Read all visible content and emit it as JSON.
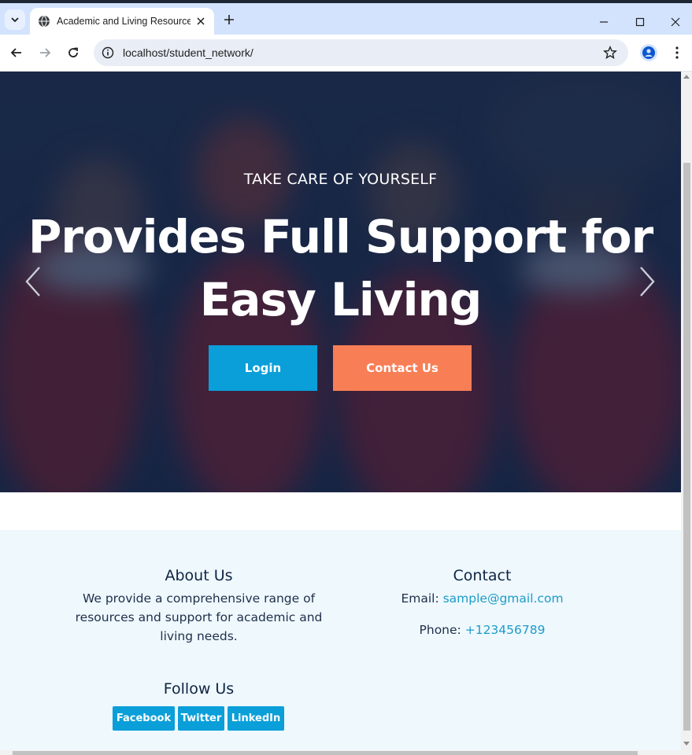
{
  "browser": {
    "tab_title": "Academic and Living Resource Network",
    "url": "localhost/student_network/",
    "icons": {
      "tab_search": "chevron-down-icon",
      "favicon": "globe-icon",
      "tab_close": "close-icon",
      "new_tab": "plus-icon",
      "back": "arrow-left-icon",
      "forward": "arrow-right-icon",
      "reload": "reload-icon",
      "site_info": "info-icon",
      "bookmark": "star-icon",
      "profile": "person-icon",
      "menu": "more-vertical-icon",
      "minimize": "minimize-icon",
      "maximize": "maximize-icon",
      "close": "close-icon"
    }
  },
  "hero": {
    "subtitle": "TAKE CARE OF YOURSELF",
    "title": "Provides Full Support for Easy Living",
    "login_label": "Login",
    "contact_label": "Contact Us"
  },
  "footer": {
    "about": {
      "heading": "About Us",
      "text": "We provide a comprehensive range of resources and support for academic and living needs."
    },
    "follow": {
      "heading": "Follow Us",
      "links": [
        "Facebook",
        "Twitter",
        "LinkedIn"
      ]
    },
    "contact": {
      "heading": "Contact",
      "email_label": "Email:",
      "email": "sample@gmail.com",
      "phone_label": "Phone:",
      "phone": "+123456789"
    }
  },
  "colors": {
    "primary_button": "#0a9fd9",
    "contact_button": "#f87e55",
    "footer_bg": "#eef8fd",
    "link": "#1d9cc9",
    "hero_overlay": "#1c2a48"
  }
}
